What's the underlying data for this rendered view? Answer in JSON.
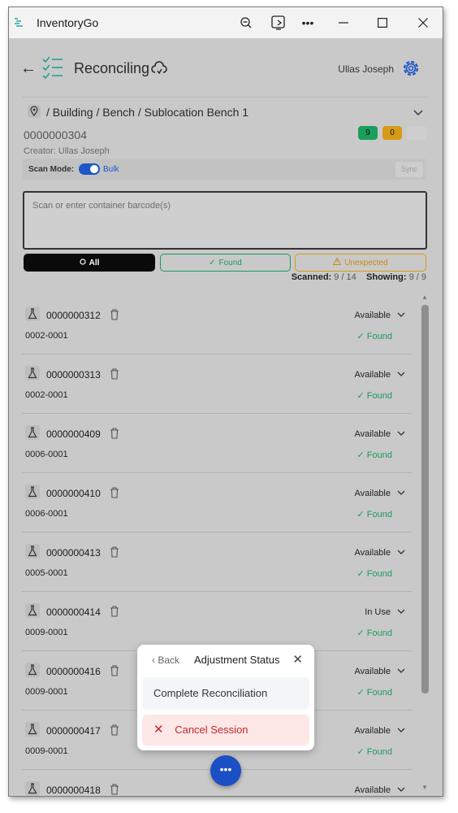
{
  "window": {
    "title": "InventoryGo"
  },
  "header": {
    "title": "Reconciling",
    "user": "Ullas Joseph"
  },
  "session": {
    "location_path": "/ Building / Bench / Sublocation Bench 1",
    "id": "0000000304",
    "badge_found": "9",
    "badge_unexpected": "0",
    "creator": "Creator: Ullas Joseph",
    "scan_mode_label": "Scan Mode:",
    "scan_mode_value": "Bulk",
    "sync_label": "Sync"
  },
  "input": {
    "placeholder": "Scan or enter container barcode(s)"
  },
  "filters": {
    "all": "All",
    "found": "Found",
    "unexpected": "Unexpected"
  },
  "counts": {
    "scanned_label": "Scanned:",
    "scanned_value": "9 / 14",
    "showing_label": "Showing:",
    "showing_value": "9 / 9"
  },
  "rows": [
    {
      "id": "0000000312",
      "loc": "0002-0001",
      "status": "Available",
      "found": "Found"
    },
    {
      "id": "0000000313",
      "loc": "0002-0001",
      "status": "Available",
      "found": "Found"
    },
    {
      "id": "0000000409",
      "loc": "0006-0001",
      "status": "Available",
      "found": "Found"
    },
    {
      "id": "0000000410",
      "loc": "0006-0001",
      "status": "Available",
      "found": "Found"
    },
    {
      "id": "0000000413",
      "loc": "0005-0001",
      "status": "Available",
      "found": "Found"
    },
    {
      "id": "0000000414",
      "loc": "0009-0001",
      "status": "In Use",
      "found": "Found"
    },
    {
      "id": "0000000416",
      "loc": "0009-0001",
      "status": "Available",
      "found": "Found"
    },
    {
      "id": "0000000417",
      "loc": "0009-0001",
      "status": "Available",
      "found": "Found"
    },
    {
      "id": "0000000418",
      "loc": "",
      "status": "Available",
      "found": ""
    }
  ],
  "popup": {
    "back": "Back",
    "title": "Adjustment Status",
    "complete": "Complete Reconciliation",
    "cancel": "Cancel Session"
  },
  "fab": {
    "label": "•••"
  },
  "colors": {
    "accent": "#1d57c7",
    "found": "#1b9a5e",
    "unexpected": "#d79a15",
    "danger": "#c4282b"
  }
}
